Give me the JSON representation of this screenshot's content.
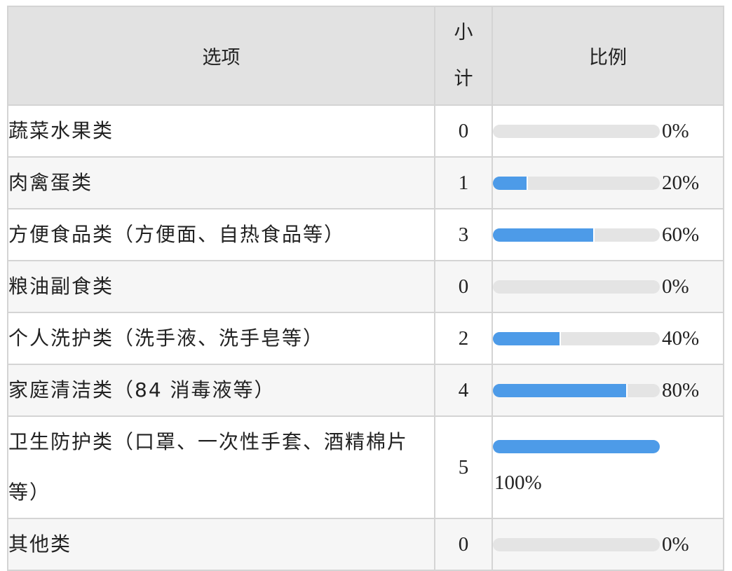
{
  "header": {
    "option": "选项",
    "count_line1": "小",
    "count_line2": "计",
    "ratio": "比例"
  },
  "rows": [
    {
      "option": "蔬菜水果类",
      "count": "0",
      "percent_label": "0%",
      "fraction": 0
    },
    {
      "option": "肉禽蛋类",
      "count": "1",
      "percent_label": "20%",
      "fraction": 0.2
    },
    {
      "option": "方便食品类（方便面、自热食品等）",
      "count": "3",
      "percent_label": "60%",
      "fraction": 0.6
    },
    {
      "option": "粮油副食类",
      "count": "0",
      "percent_label": "0%",
      "fraction": 0
    },
    {
      "option": "个人洗护类（洗手液、洗手皂等）",
      "count": "2",
      "percent_label": "40%",
      "fraction": 0.4
    },
    {
      "option": "家庭清洁类（84 消毒液等）",
      "count": "4",
      "percent_label": "80%",
      "fraction": 0.8
    },
    {
      "option": "卫生防护类（口罩、一次性手套、酒精棉片等）",
      "count": "5",
      "percent_label": "100%",
      "fraction": 1
    },
    {
      "option": "其他类",
      "count": "0",
      "percent_label": "0%",
      "fraction": 0
    }
  ],
  "colors": {
    "bar_fill": "#4d9be8",
    "bar_track": "#e4e4e4",
    "header_bg": "#e2e2e2"
  }
}
